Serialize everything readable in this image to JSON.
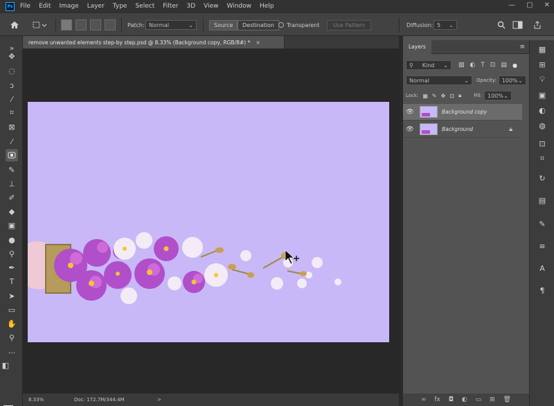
{
  "app": {
    "logo": "Ps",
    "colors": {
      "foreground": "#e01010",
      "background": "#000000",
      "canvas": "#c8b8f7"
    }
  },
  "menu": [
    "File",
    "Edit",
    "Image",
    "Layer",
    "Type",
    "Select",
    "Filter",
    "3D",
    "View",
    "Window",
    "Help"
  ],
  "window_controls": {
    "minimize": "—",
    "maximize": "▢",
    "close": "✕"
  },
  "options": {
    "patch_label": "Patch:",
    "patch_value": "Normal",
    "source": "Source",
    "destination": "Destination",
    "transparent": "Transparent",
    "use_pattern": "Use Pattern",
    "diffusion_label": "Diffusion:",
    "diffusion_value": "5"
  },
  "document": {
    "tab_title": "remove unwanted elements step-by step.psd @ 8.33% (Background copy, RGB/8#) *",
    "close": "×",
    "zoom": "8.33%",
    "doc_info": "Doc: 172.7M/344.4M",
    "arrow": ">"
  },
  "layers": {
    "panel_title": "Layers",
    "filter_kind": "Kind",
    "blend_mode": "Normal",
    "opacity_label": "Opacity:",
    "opacity_value": "100%",
    "lock_label": "Lock:",
    "fill_label": "Fill:",
    "fill_value": "100%",
    "items": [
      {
        "name": "Background copy",
        "selected": true,
        "locked": false
      },
      {
        "name": "Background",
        "selected": false,
        "locked": true
      }
    ]
  }
}
